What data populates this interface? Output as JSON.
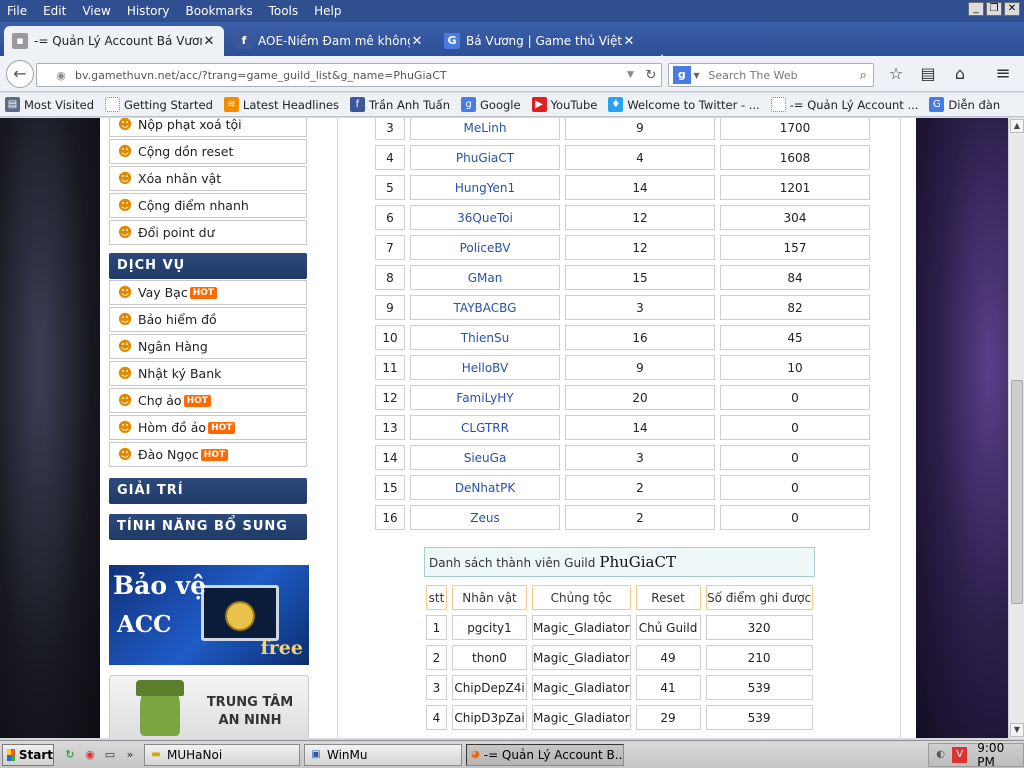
{
  "menubar": {
    "items": [
      "File",
      "Edit",
      "View",
      "History",
      "Bookmarks",
      "Tools",
      "Help"
    ]
  },
  "tabs": [
    {
      "title": "-= Quản Lý Account Bá Vương =- ...",
      "icon": "page-icon",
      "active": true
    },
    {
      "title": "AOE-Niềm Đam mê không bao...",
      "icon": "facebook-icon",
      "active": false
    },
    {
      "title": "Bá Vương | Game thủ Việt Na...",
      "icon": "g-icon",
      "active": false
    }
  ],
  "nav": {
    "url": "bv.gamethuvn.net/acc/?trang=game_guild_list&g_name=PhuGiaCT",
    "search_placeholder": "Search The Web"
  },
  "bookmarks": [
    {
      "label": "Most Visited",
      "icon": "bookmark-icon",
      "color": "#5a6a8a"
    },
    {
      "label": "Getting Started",
      "icon": "page-icon",
      "color": "#9a9a9a"
    },
    {
      "label": "Latest Headlines",
      "icon": "rss-icon",
      "color": "#f08c00"
    },
    {
      "label": "Trần Anh Tuấn",
      "icon": "facebook-icon",
      "color": "#3b5998"
    },
    {
      "label": "Google",
      "icon": "google-icon",
      "color": "#4a7be0"
    },
    {
      "label": "YouTube",
      "icon": "youtube-icon",
      "color": "#e02020"
    },
    {
      "label": "Welcome to Twitter - ...",
      "icon": "twitter-icon",
      "color": "#2aa3ef"
    },
    {
      "label": "-= Quản Lý Account ...",
      "icon": "page-icon",
      "color": "#9a9a9a"
    },
    {
      "label": "Diễn đàn",
      "icon": "g-icon",
      "color": "#4a7be0"
    }
  ],
  "sidebar": {
    "top_items": [
      {
        "label": "Nộp phạt xoá tội"
      },
      {
        "label": "Cộng dồn reset"
      },
      {
        "label": "Xóa nhân vật"
      },
      {
        "label": "Cộng điểm nhanh"
      },
      {
        "label": "Đổi point dư"
      }
    ],
    "services_heading": "DỊCH VỤ",
    "services": [
      {
        "label": "Vay Bạc",
        "hot": "HOT"
      },
      {
        "label": "Bảo hiểm đồ",
        "hot": ""
      },
      {
        "label": "Ngân Hàng",
        "hot": ""
      },
      {
        "label": "Nhật ký Bank",
        "hot": ""
      },
      {
        "label": "Chợ ảo",
        "hot": "HOT"
      },
      {
        "label": "Hòm đồ ảo",
        "hot": "HOT"
      },
      {
        "label": "Đào Ngọc",
        "hot": "HOT"
      }
    ],
    "heading_entertainment": "GIẢI TRÍ",
    "heading_extra": "TÍNH NĂNG BỔ SUNG",
    "banner_acc": {
      "line1": "Bảo vệ",
      "line2": "ACC",
      "line3": "free"
    },
    "banner_security": {
      "line1": "TRUNG TÂM",
      "line2": "AN NINH"
    }
  },
  "guild_ranking": [
    {
      "rank": "3",
      "name": "MeLinh",
      "members": "9",
      "score": "1700"
    },
    {
      "rank": "4",
      "name": "PhuGiaCT",
      "members": "4",
      "score": "1608"
    },
    {
      "rank": "5",
      "name": "HungYen1",
      "members": "14",
      "score": "1201"
    },
    {
      "rank": "6",
      "name": "36QueToi",
      "members": "12",
      "score": "304"
    },
    {
      "rank": "7",
      "name": "PoliceBV",
      "members": "12",
      "score": "157"
    },
    {
      "rank": "8",
      "name": "GMan",
      "members": "15",
      "score": "84"
    },
    {
      "rank": "9",
      "name": "TAYBACBG",
      "members": "3",
      "score": "82"
    },
    {
      "rank": "10",
      "name": "ThienSu",
      "members": "16",
      "score": "45"
    },
    {
      "rank": "11",
      "name": "HelloBV",
      "members": "9",
      "score": "10"
    },
    {
      "rank": "12",
      "name": "FamiLyHY",
      "members": "20",
      "score": "0"
    },
    {
      "rank": "13",
      "name": "CLGTRR",
      "members": "14",
      "score": "0"
    },
    {
      "rank": "14",
      "name": "SieuGa",
      "members": "3",
      "score": "0"
    },
    {
      "rank": "15",
      "name": "DeNhatPK",
      "members": "2",
      "score": "0"
    },
    {
      "rank": "16",
      "name": "Zeus",
      "members": "2",
      "score": "0"
    }
  ],
  "members": {
    "title_prefix": "Danh sách thành viên Guild",
    "guild_name": "PhuGiaCT",
    "headers": [
      "stt",
      "Nhân vật",
      "Chủng tộc",
      "Reset",
      "Số điểm ghi được"
    ],
    "rows": [
      [
        "1",
        "pgcity1",
        "Magic_Gladiator",
        "Chủ Guild",
        "320"
      ],
      [
        "2",
        "thon0",
        "Magic_Gladiator",
        "49",
        "210"
      ],
      [
        "3",
        "ChipDepZ4i",
        "Magic_Gladiator",
        "41",
        "539"
      ],
      [
        "4",
        "ChipD3pZai",
        "Magic_Gladiator",
        "29",
        "539"
      ]
    ]
  },
  "taskbar": {
    "start": "Start",
    "windows": [
      {
        "label": "MUHaNoi",
        "icon": "folder-icon"
      },
      {
        "label": "WinMu",
        "icon": "window-icon"
      },
      {
        "label": "-= Quản Lý Account B...",
        "icon": "firefox-icon",
        "active": true
      }
    ],
    "clock": "9:00 PM"
  }
}
